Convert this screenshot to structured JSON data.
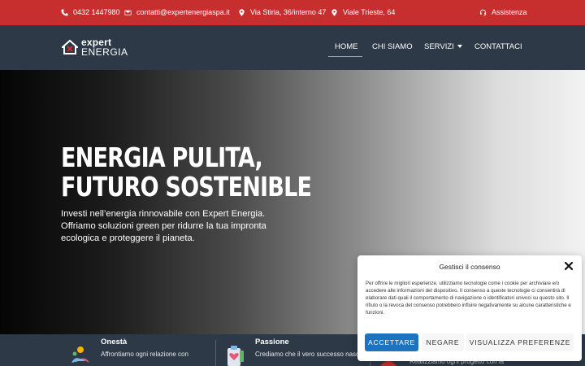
{
  "topbar": {
    "phone": "0432 1447980",
    "email": "contatti@expertenergiaspa.it",
    "address1": "Via Stiria, 36/interno 47",
    "address2": "Viale Trieste, 64",
    "assist": "Assistenza",
    "color": "#c62f2d"
  },
  "nav": {
    "logo_line1": "expert",
    "logo_line2": "ENERGIA",
    "items": [
      {
        "label": "HOME"
      },
      {
        "label": "CHI SIAMO"
      },
      {
        "label": "SERVIZI"
      },
      {
        "label": "CONTATTACI"
      }
    ],
    "background": "#2d3947"
  },
  "hero": {
    "title_line1": "ENERGIA PULITA,",
    "title_line2": "FUTURO SOSTENIBLE",
    "lead": "Investi nell’energia rinnovabile con Expert Energia. Offriamo soluzioni green per ridurre la tua impronta ecologica e proteggere il pianeta."
  },
  "features": [
    {
      "title": "Onestà",
      "desc": "Affrontiamo ogni relazione con"
    },
    {
      "title": "Passione",
      "desc": "Crediamo che il vero successo nasca"
    },
    {
      "title": "",
      "desc": "Realizziamo ogni progetto con la"
    }
  ],
  "consent": {
    "title": "Gestisci il consenso",
    "text": "Per offrire le migliori esperienze, utilizziamo tecnologie come i cookie per archiviare e/o accedere alle informazioni del dispositivo. Il consenso a queste tecnologie ci consentirà di elaborare dati quali il comportamento di navigazione o identificatori univoci su questo sito. Il rifiuto o la revoca del consenso potrebbero influire negativamente su alcune caratteristiche e funzioni.",
    "accept": "ACCETTARE",
    "deny": "NEGARE",
    "prefs": "VISUALIZZA PREFERENZE",
    "accent": "#1e73be"
  }
}
